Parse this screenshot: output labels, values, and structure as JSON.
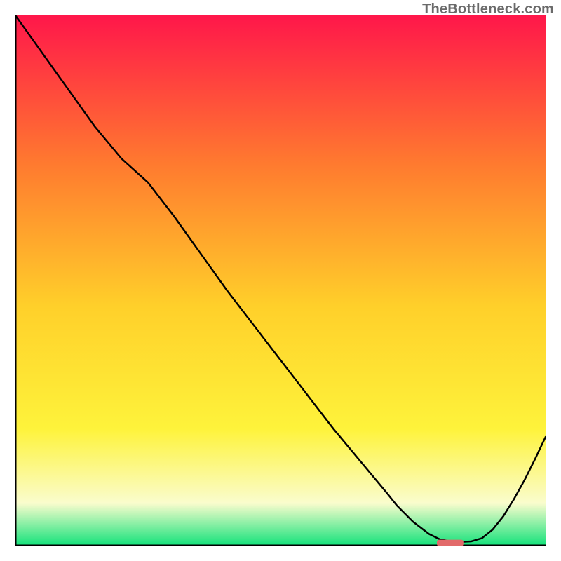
{
  "watermark": "TheBottleneck.com",
  "chart_data": {
    "type": "line",
    "title": "",
    "xlabel": "",
    "ylabel": "",
    "xlim": [
      0,
      100
    ],
    "ylim": [
      0,
      100
    ],
    "grid": false,
    "legend": false,
    "gradient_background": {
      "top_color": "#ff174a",
      "mid_upper": "#ff7a2f",
      "mid": "#ffd02a",
      "mid_lower": "#fef33b",
      "band_pale": "#fafccd",
      "bottom_color": "#14e27b"
    },
    "series": [
      {
        "name": "curve",
        "color": "#000000",
        "x": [
          0,
          5,
          10,
          15,
          20,
          25,
          30,
          35,
          40,
          45,
          50,
          55,
          60,
          65,
          70,
          72,
          75,
          78,
          80,
          82,
          84,
          86,
          88,
          90,
          92,
          94,
          96,
          98,
          100
        ],
        "y": [
          100,
          93,
          86,
          79,
          73,
          68.5,
          62,
          55,
          48,
          41.5,
          35,
          28.5,
          22,
          16,
          10,
          7.5,
          4.5,
          2.2,
          1.2,
          0.8,
          0.7,
          0.8,
          1.4,
          3.0,
          5.5,
          8.7,
          12.3,
          16.3,
          20.5
        ]
      }
    ],
    "marker": {
      "color": "#e26a6a",
      "x_center": 82,
      "y_center": 0.5,
      "width": 5,
      "height": 1.2,
      "rx": 3
    },
    "axes": {
      "stroke": "#000000",
      "stroke_width": 3
    }
  }
}
